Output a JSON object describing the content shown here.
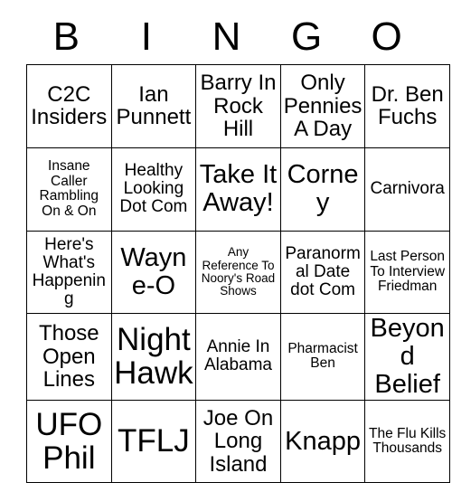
{
  "card": {
    "header_letters": [
      "B",
      "I",
      "N",
      "G",
      "O"
    ],
    "rows": [
      [
        {
          "text": "C2C Insiders",
          "size": "fs-lg"
        },
        {
          "text": "Ian Punnett",
          "size": "fs-lg"
        },
        {
          "text": "Barry In Rock Hill",
          "size": "fs-lg"
        },
        {
          "text": "Only Pennies A Day",
          "size": "fs-lg"
        },
        {
          "text": "Dr. Ben Fuchs",
          "size": "fs-lg"
        }
      ],
      [
        {
          "text": "Insane Caller Rambling On & On",
          "size": "fs-sm"
        },
        {
          "text": "Healthy Looking Dot Com",
          "size": "fs-md"
        },
        {
          "text": "Take It Away!",
          "size": "fs-xl"
        },
        {
          "text": "Corney",
          "size": "fs-xl"
        },
        {
          "text": "Carnivora",
          "size": "fs-md"
        }
      ],
      [
        {
          "text": "Here's What's Happening",
          "size": "fs-md"
        },
        {
          "text": "Wayne-O",
          "size": "fs-xl"
        },
        {
          "text": "Any Reference To Noory's Road Shows",
          "size": "fs-xs"
        },
        {
          "text": "Paranormal Date dot Com",
          "size": "fs-md"
        },
        {
          "text": "Last Person To Interview Friedman",
          "size": "fs-sm"
        }
      ],
      [
        {
          "text": "Those Open Lines",
          "size": "fs-lg"
        },
        {
          "text": "Night Hawk",
          "size": "fs-xxl"
        },
        {
          "text": "Annie In Alabama",
          "size": "fs-md"
        },
        {
          "text": "Pharmacist Ben",
          "size": "fs-sm"
        },
        {
          "text": "Beyond Belief",
          "size": "fs-xl"
        }
      ],
      [
        {
          "text": "UFO Phil",
          "size": "fs-xxl"
        },
        {
          "text": "TFLJ",
          "size": "fs-xxl"
        },
        {
          "text": "Joe On Long Island",
          "size": "fs-lg"
        },
        {
          "text": "Knapp",
          "size": "fs-xl"
        },
        {
          "text": "The Flu Kills Thousands",
          "size": "fs-sm"
        }
      ]
    ]
  },
  "colors": {
    "background": "#ffffff",
    "text": "#000000",
    "grid_line": "#000000"
  }
}
